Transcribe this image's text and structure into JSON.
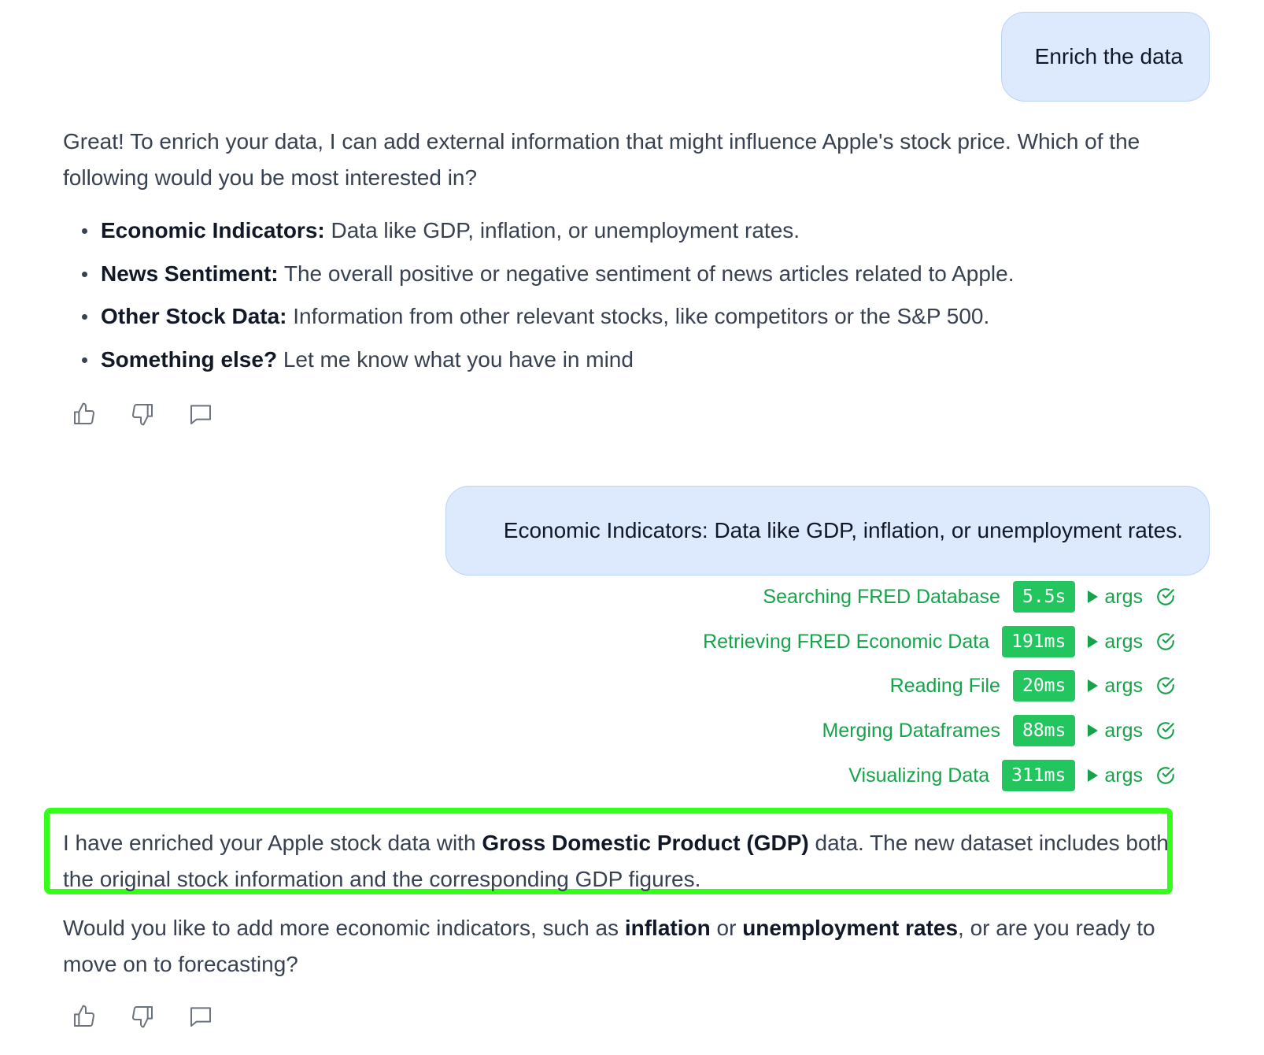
{
  "messages": {
    "user1": "Enrich the data",
    "assistant1_intro": "Great! To enrich your data, I can add external information that might influence Apple's stock price. Which of the following would you be most interested in?",
    "options": [
      {
        "title": "Economic Indicators:",
        "text": " Data like GDP, inflation, or unemployment rates."
      },
      {
        "title": "News Sentiment:",
        "text": " The overall positive or negative sentiment of news articles related to Apple."
      },
      {
        "title": "Other Stock Data:",
        "text": " Information from other relevant stocks, like competitors or the S&P 500."
      },
      {
        "title": "Something else?",
        "text": " Let me know what you have in mind"
      }
    ],
    "user2": "Economic Indicators: Data like GDP, inflation, or unemployment rates.",
    "assistant2_p1_a": "I have enriched your Apple stock data with ",
    "assistant2_p1_b": "Gross Domestic Product (GDP)",
    "assistant2_p1_c": " data. The new dataset includes both the original stock information and the corresponding GDP figures.",
    "assistant2_p2_a": "Would you like to add more economic indicators, such as ",
    "assistant2_p2_b": "inflation",
    "assistant2_p2_c": " or ",
    "assistant2_p2_d": "unemployment rates",
    "assistant2_p2_e": ", or are you ready to move on to forecasting?"
  },
  "tools": [
    {
      "name": "Searching FRED Database",
      "duration": "5.5s",
      "args_label": "args"
    },
    {
      "name": "Retrieving FRED Economic Data",
      "duration": "191ms",
      "args_label": "args"
    },
    {
      "name": "Reading File",
      "duration": "20ms",
      "args_label": "args"
    },
    {
      "name": "Merging Dataframes",
      "duration": "88ms",
      "args_label": "args"
    },
    {
      "name": "Visualizing Data",
      "duration": "311ms",
      "args_label": "args"
    }
  ],
  "icons": {
    "feedback": [
      "thumbs-up-icon",
      "thumbs-down-icon",
      "comment-icon"
    ],
    "tool_status": "check-circle-icon"
  },
  "colors": {
    "user_bubble": "#dde9fc",
    "tool_green": "#16a34a",
    "badge_green": "#22c55e",
    "highlight": "#33ff1a"
  }
}
